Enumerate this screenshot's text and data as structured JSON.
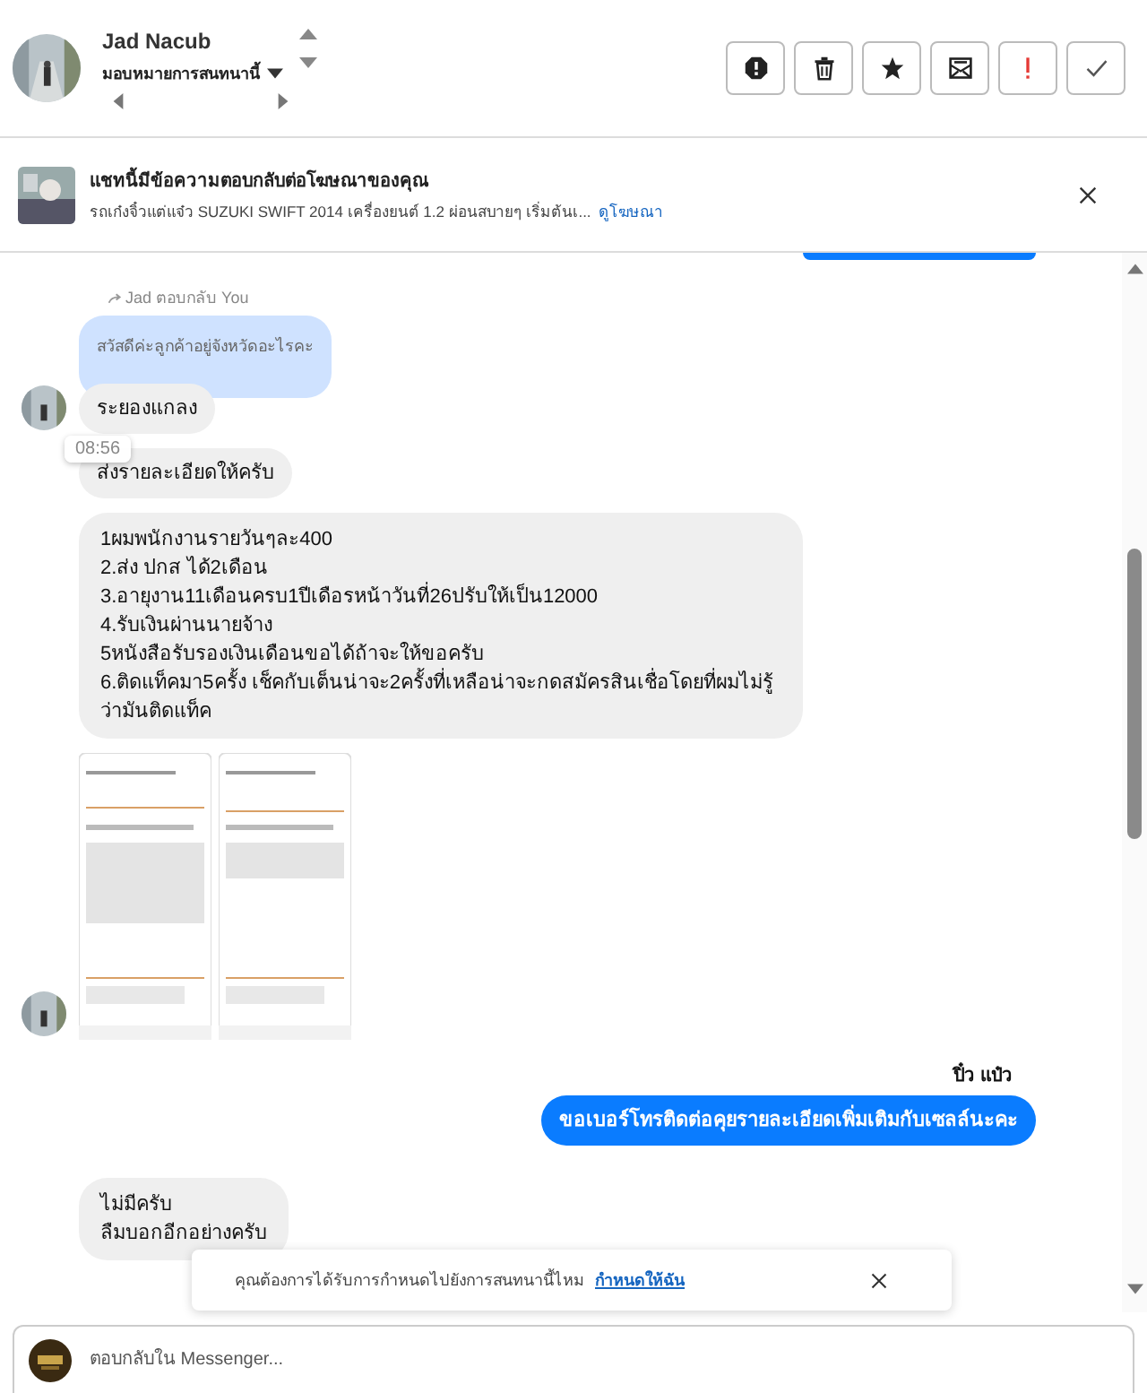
{
  "header": {
    "name": "Jad Nacub",
    "assign_label": "มอบหมายการสนทนานี้",
    "actions": [
      {
        "kind": "block"
      },
      {
        "kind": "trash"
      },
      {
        "kind": "star"
      },
      {
        "kind": "mail"
      },
      {
        "kind": "important"
      },
      {
        "kind": "done"
      }
    ]
  },
  "ad_banner": {
    "title": "แชทนี้มีข้อความตอบกลับต่อโฆษณาของคุณ",
    "snippet": "รถเก๋งจิ๋วแต่แจ๋ว SUZUKI SWIFT 2014 เครื่องยนต์ 1.2 ผ่อนสบายๆ เริ่มต้นเ...",
    "link": "ดูโฆษณา"
  },
  "messages": [
    {
      "kind": "cut_outgoing"
    },
    {
      "kind": "reply_label",
      "text": "Jad ตอบกลับ You"
    },
    {
      "kind": "quoted",
      "text": "สวัสดีค่ะลูกค้าอยู่จังหวัดอะไรคะ"
    },
    {
      "kind": "incoming",
      "lines": [
        "ระยองแกลง"
      ],
      "avatar": true
    },
    {
      "kind": "incoming",
      "lines": [
        "ส่งรายละเอียดให้ครับ"
      ],
      "avatar": false,
      "tooltip": "08:56"
    },
    {
      "kind": "incoming",
      "lines": [
        "1ผมพนักงานรายวันๆละ400",
        "2.ส่ง ปกส ได้2เดือน",
        "3.อายุงาน11เดือนครบ1ปีเดือรหน้าวันที่26ปรับให้เป็น12000",
        "4.รับเงินผ่านนายจ้าง",
        "5หนังสือรับรองเงินเดือนขอได้ถ้าจะให้ขอครับ",
        "6.ติดแท็คมา5ครั้ง เช็คกับเต็นน่าจะ2ครั้งที่เหลือน่าจะกดสมัครสินเชื่อโดยที่ผมไม่รู้ว่ามันติดแท็ค"
      ],
      "avatar": false
    },
    {
      "kind": "images",
      "avatar": true
    },
    {
      "kind": "sender",
      "text": "ปิ๋ว แป๋ว"
    },
    {
      "kind": "outgoing",
      "lines": [
        "ขอเบอร์โทรติดต่อคุยรายละเอียดเพิ่มเติมกับเซลล์นะคะ"
      ]
    },
    {
      "kind": "incoming",
      "lines": [
        "ไม่มีครับ",
        "ลืมบอกอีกอย่างครับ"
      ],
      "avatar": false
    }
  ],
  "assign_toast": {
    "text": "คุณต้องการได้รับการกำหนดไปยังการสนทนานี้ไหม",
    "link": "กำหนดให้ฉัน"
  },
  "composer": {
    "placeholder": "ตอบกลับใน Messenger..."
  }
}
